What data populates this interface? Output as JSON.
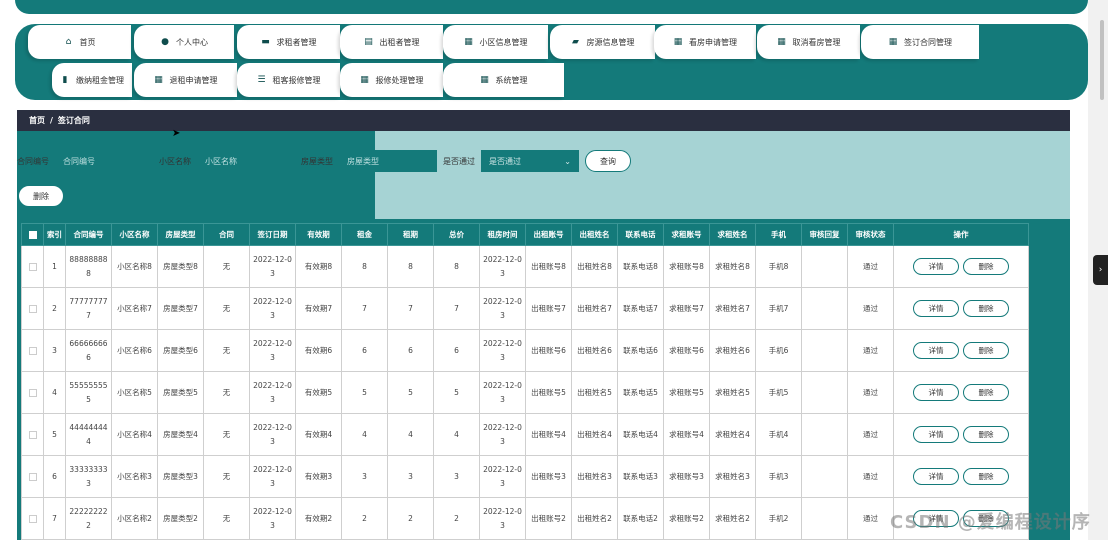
{
  "menu": {
    "row1": [
      {
        "label": "首页",
        "icon": "home-icon",
        "glyph": "⌂"
      },
      {
        "label": "个人中心",
        "icon": "user-icon",
        "glyph": "●"
      },
      {
        "label": "求租者管理",
        "icon": "chat-icon",
        "glyph": "▬"
      },
      {
        "label": "出租者管理",
        "icon": "document-icon",
        "glyph": "▤"
      },
      {
        "label": "小区信息管理",
        "icon": "grid-icon",
        "glyph": "▦"
      },
      {
        "label": "房源信息管理",
        "icon": "briefcase-icon",
        "glyph": "▰"
      },
      {
        "label": "看房申请管理",
        "icon": "grid-icon",
        "glyph": "▦"
      },
      {
        "label": "取消看房管理",
        "icon": "grid-icon",
        "glyph": "▦"
      },
      {
        "label": "签订合同管理",
        "icon": "grid-icon",
        "glyph": "▦"
      }
    ],
    "row2": [
      {
        "label": "缴纳租金管理",
        "icon": "bar-chart-icon",
        "glyph": "▮"
      },
      {
        "label": "退租申请管理",
        "icon": "grid-icon",
        "glyph": "▦"
      },
      {
        "label": "租客报修管理",
        "icon": "sliders-icon",
        "glyph": "☰"
      },
      {
        "label": "报修处理管理",
        "icon": "grid-icon",
        "glyph": "▦"
      },
      {
        "label": "系统管理",
        "icon": "grid-icon",
        "glyph": "▦"
      }
    ]
  },
  "breadcrumb": {
    "home": "首页",
    "sep": "/",
    "current": "签订合同"
  },
  "search": {
    "contract_label": "合同编号",
    "contract_placeholder": "合同编号",
    "community_label": "小区名称",
    "community_placeholder": "小区名称",
    "house_type_label": "房屋类型",
    "house_type_placeholder": "房屋类型",
    "approved_label": "是否通过",
    "approved_placeholder": "是否通过",
    "query_button": "查询",
    "delete_button": "删除"
  },
  "table": {
    "headers": [
      "索引",
      "合同编号",
      "小区名称",
      "房屋类型",
      "合同",
      "签订日期",
      "有效期",
      "租金",
      "租期",
      "总价",
      "租房时间",
      "出租账号",
      "出租姓名",
      "联系电话",
      "求租账号",
      "求租姓名",
      "手机",
      "审核回复",
      "审核状态",
      "操作"
    ],
    "detail_label": "详情",
    "delete_label": "删除",
    "rows": [
      [
        "1",
        "888888888",
        "小区名称8",
        "房屋类型8",
        "无",
        "2022-12-03",
        "有效期8",
        "8",
        "8",
        "8",
        "2022-12-03",
        "出租账号8",
        "出租姓名8",
        "联系电话8",
        "求租账号8",
        "求租姓名8",
        "手机8",
        "",
        "通过"
      ],
      [
        "2",
        "777777777",
        "小区名称7",
        "房屋类型7",
        "无",
        "2022-12-03",
        "有效期7",
        "7",
        "7",
        "7",
        "2022-12-03",
        "出租账号7",
        "出租姓名7",
        "联系电话7",
        "求租账号7",
        "求租姓名7",
        "手机7",
        "",
        "通过"
      ],
      [
        "3",
        "666666666",
        "小区名称6",
        "房屋类型6",
        "无",
        "2022-12-03",
        "有效期6",
        "6",
        "6",
        "6",
        "2022-12-03",
        "出租账号6",
        "出租姓名6",
        "联系电话6",
        "求租账号6",
        "求租姓名6",
        "手机6",
        "",
        "通过"
      ],
      [
        "4",
        "555555555",
        "小区名称5",
        "房屋类型5",
        "无",
        "2022-12-03",
        "有效期5",
        "5",
        "5",
        "5",
        "2022-12-03",
        "出租账号5",
        "出租姓名5",
        "联系电话5",
        "求租账号5",
        "求租姓名5",
        "手机5",
        "",
        "通过"
      ],
      [
        "5",
        "444444444",
        "小区名称4",
        "房屋类型4",
        "无",
        "2022-12-03",
        "有效期4",
        "4",
        "4",
        "4",
        "2022-12-03",
        "出租账号4",
        "出租姓名4",
        "联系电话4",
        "求租账号4",
        "求租姓名4",
        "手机4",
        "",
        "通过"
      ],
      [
        "6",
        "333333333",
        "小区名称3",
        "房屋类型3",
        "无",
        "2022-12-03",
        "有效期3",
        "3",
        "3",
        "3",
        "2022-12-03",
        "出租账号3",
        "出租姓名3",
        "联系电话3",
        "求租账号3",
        "求租姓名3",
        "手机3",
        "",
        "通过"
      ],
      [
        "7",
        "222222222",
        "小区名称2",
        "房屋类型2",
        "无",
        "2022-12-03",
        "有效期2",
        "2",
        "2",
        "2",
        "2022-12-03",
        "出租账号2",
        "出租姓名2",
        "联系电话2",
        "求租账号2",
        "求租姓名2",
        "手机2",
        "",
        "通过"
      ]
    ]
  },
  "watermark": "CSDN @爱编程设计序",
  "colors": {
    "primary": "#147a7a",
    "breadcrumb_bg": "#2a2f40",
    "content_bg": "#a6d3d4"
  }
}
